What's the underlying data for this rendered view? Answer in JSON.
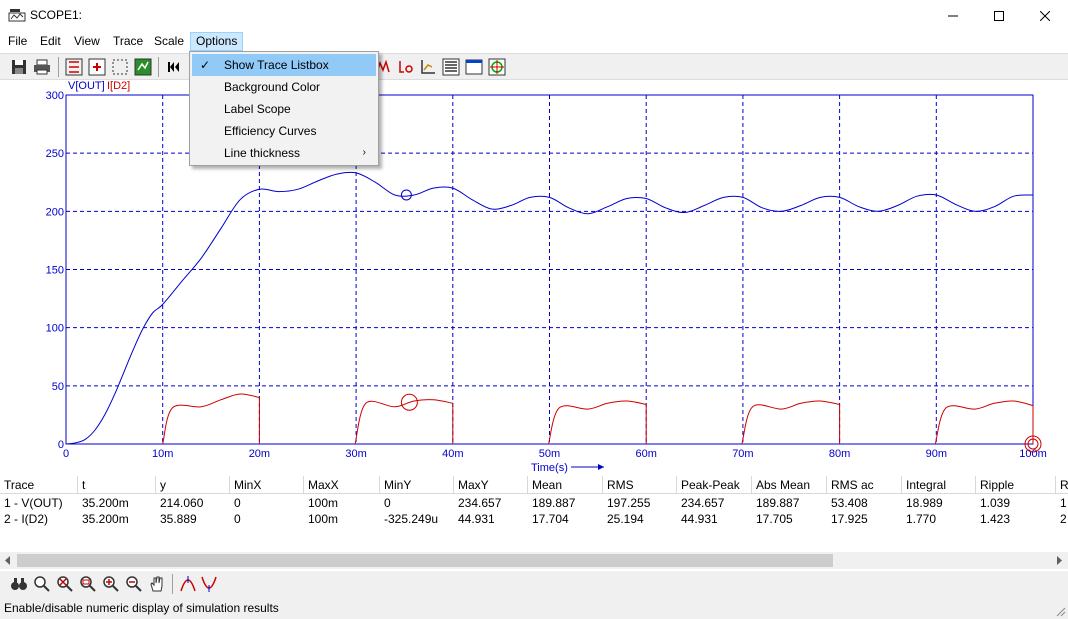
{
  "window": {
    "title": "SCOPE1:",
    "icon_label": "SIMETRIX"
  },
  "menubar": {
    "items": [
      {
        "label": "File"
      },
      {
        "label": "Edit"
      },
      {
        "label": "View"
      },
      {
        "label": "Trace"
      },
      {
        "label": "Scale"
      },
      {
        "label": "Options",
        "active": true
      }
    ]
  },
  "options_menu": {
    "items": [
      {
        "label": "Show Trace Listbox",
        "checked": true,
        "highlighted": true
      },
      {
        "label": "Background Color"
      },
      {
        "label": "Label Scope"
      },
      {
        "label": "Efficiency Curves"
      },
      {
        "label": "Line thickness",
        "submenu": true
      }
    ]
  },
  "plot": {
    "legend": [
      {
        "label": "V[OUT]",
        "color": "#0000cc"
      },
      {
        "label": "I[D2]",
        "color": "#cc0000"
      }
    ],
    "y_ticks": [
      "300",
      "250",
      "200",
      "150",
      "100",
      "50",
      "0"
    ],
    "x_ticks": [
      "0",
      "10m",
      "20m",
      "30m",
      "40m",
      "50m",
      "60m",
      "70m",
      "80m",
      "90m",
      "100m"
    ],
    "x_axis_label": "Time(s)",
    "grid_color": "#0000cc",
    "cursor_color_v": "#0000cc",
    "cursor_color_i": "#cc0000"
  },
  "chart_data": {
    "type": "line",
    "x_unit": "s",
    "xlim": [
      0,
      0.1
    ],
    "ylim": [
      0,
      300
    ],
    "xlabel": "Time(s)",
    "grid": true,
    "series": [
      {
        "name": "V[OUT]",
        "color": "#0000cc",
        "x": [
          0,
          0.001,
          0.002,
          0.003,
          0.004,
          0.005,
          0.006,
          0.007,
          0.008,
          0.009,
          0.01,
          0.012,
          0.014,
          0.016,
          0.018,
          0.02,
          0.022,
          0.024,
          0.026,
          0.028,
          0.03,
          0.032,
          0.034,
          0.036,
          0.038,
          0.04,
          0.042,
          0.044,
          0.046,
          0.048,
          0.05,
          0.052,
          0.054,
          0.056,
          0.058,
          0.06,
          0.062,
          0.064,
          0.066,
          0.068,
          0.07,
          0.072,
          0.074,
          0.076,
          0.078,
          0.08,
          0.082,
          0.084,
          0.086,
          0.088,
          0.09,
          0.092,
          0.094,
          0.096,
          0.098,
          0.1
        ],
        "y": [
          0,
          1,
          4,
          12,
          25,
          42,
          62,
          82,
          100,
          113,
          120,
          140,
          160,
          185,
          210,
          219,
          217,
          219,
          226,
          232,
          233,
          225,
          214,
          214,
          220,
          220,
          210,
          202,
          205,
          212,
          212,
          203,
          198,
          204,
          211,
          211,
          203,
          199,
          205,
          212,
          212,
          203,
          200,
          205,
          212,
          212,
          204,
          200,
          205,
          213,
          214,
          206,
          200,
          204,
          213,
          214
        ]
      },
      {
        "name": "I[D2]",
        "color": "#cc0000",
        "segments": [
          {
            "x": [
              0.01,
              0.011,
              0.014,
              0.016,
              0.018,
              0.02
            ],
            "y": [
              0,
              31,
              32,
              38,
              43,
              40
            ]
          },
          {
            "x": [
              0.0299,
              0.031,
              0.034,
              0.036,
              0.038,
              0.04
            ],
            "y": [
              0,
              35,
              32,
              37,
              38,
              35
            ]
          },
          {
            "x": [
              0.0499,
              0.051,
              0.054,
              0.056,
              0.058,
              0.06
            ],
            "y": [
              0,
              31,
              30,
              35,
              37,
              34
            ]
          },
          {
            "x": [
              0.0699,
              0.071,
              0.074,
              0.076,
              0.078,
              0.08
            ],
            "y": [
              0,
              32,
              30,
              35,
              37,
              34
            ]
          },
          {
            "x": [
              0.0899,
              0.091,
              0.094,
              0.096,
              0.098,
              0.1
            ],
            "y": [
              0,
              31,
              30,
              35,
              37,
              33
            ]
          }
        ]
      }
    ],
    "cursor": {
      "x": 0.0352,
      "v_y": 214.06,
      "i_y": 35.889
    }
  },
  "results_table": {
    "columns": [
      "Trace",
      "t",
      "y",
      "MinX",
      "MaxX",
      "MinY",
      "MaxY",
      "Mean",
      "RMS",
      "Peak-Peak",
      "Abs Mean",
      "RMS ac",
      "Integral",
      "Ripple",
      "Ri"
    ],
    "rows": [
      [
        "1 - V(OUT)",
        "35.200m",
        "214.060",
        "0",
        "100m",
        "0",
        "234.657",
        "189.887",
        "197.255",
        "234.657",
        "189.887",
        "53.408",
        "18.989",
        "1.039",
        "1"
      ],
      [
        "2 - I(D2)",
        "35.200m",
        "35.889",
        "0",
        "100m",
        "-325.249u",
        "44.931",
        "17.704",
        "25.194",
        "44.931",
        "17.705",
        "17.925",
        "1.770",
        "1.423",
        "2"
      ]
    ]
  },
  "status": {
    "text": "Enable/disable numeric display of simulation results"
  }
}
